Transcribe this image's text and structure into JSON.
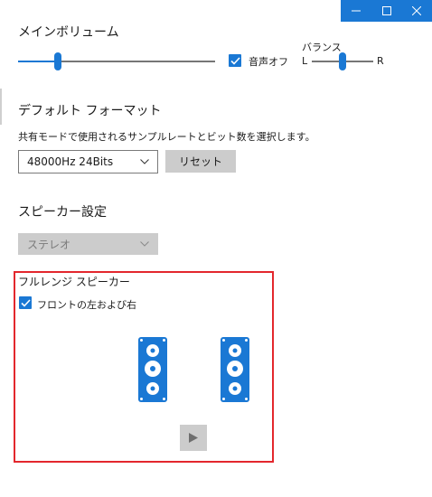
{
  "colors": {
    "accent": "#1a78d4",
    "highlight": "#e3272d",
    "disabled": "#cccccc"
  },
  "main_volume": {
    "title": "メインボリューム",
    "level": 0.2
  },
  "mute": {
    "label": "音声オフ",
    "checked": true
  },
  "balance": {
    "title": "バランス",
    "left": "L",
    "right": "R",
    "level": 0.5
  },
  "default_format": {
    "title": "デフォルト フォーマット",
    "description": "共有モードで使用されるサンプルレートとビット数を選択します。",
    "selected": "48000Hz 24Bits",
    "reset_label": "リセット"
  },
  "speaker_settings": {
    "title": "スピーカー設定",
    "selected": "ステレオ"
  },
  "fullrange": {
    "title": "フルレンジ スピーカー",
    "front_label": "フロントの左および右",
    "front_checked": true
  },
  "icons": {
    "minimize": "minimize-icon",
    "maximize": "maximize-icon",
    "close": "close-icon",
    "check": "checkmark-icon",
    "chevron": "chevron-down-icon",
    "speaker": "speaker-icon",
    "play": "play-icon"
  }
}
